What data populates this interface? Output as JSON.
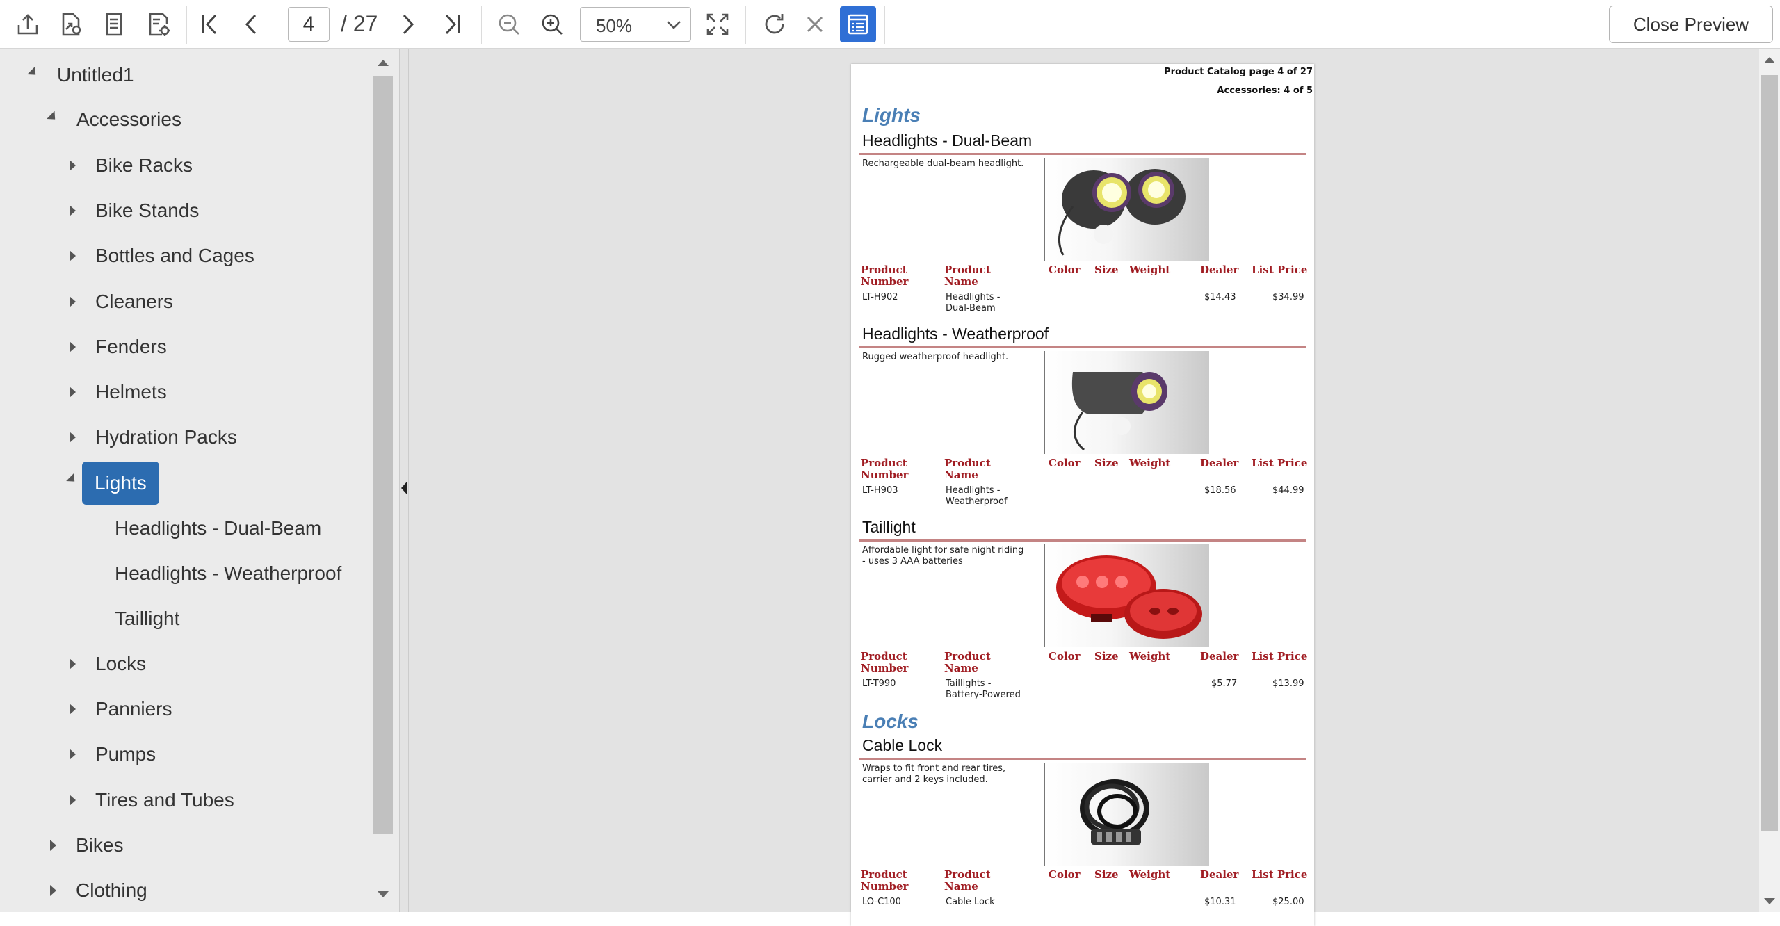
{
  "toolbar": {
    "current_page": "4",
    "total_pages": "/ 27",
    "zoom": "50%",
    "close_preview_label": "Close Preview"
  },
  "tree": {
    "root": "Untitled1",
    "accessories": "Accessories",
    "items": [
      "Bike Racks",
      "Bike Stands",
      "Bottles and Cages",
      "Cleaners",
      "Fenders",
      "Helmets",
      "Hydration Packs"
    ],
    "lights": "Lights",
    "lights_children": [
      "Headlights - Dual-Beam",
      "Headlights - Weatherproof",
      "Taillight"
    ],
    "items_after": [
      "Locks",
      "Panniers",
      "Pumps",
      "Tires and Tubes"
    ],
    "bikes": "Bikes",
    "clothing": "Clothing"
  },
  "report": {
    "header_line1": "Product Catalog page 4 of 27",
    "header_line2": "Accessories: 4 of 5",
    "columns": {
      "product_number": "Product Number",
      "product_name": "Product Name",
      "color": "Color",
      "size": "Size",
      "weight": "Weight",
      "dealer": "Dealer",
      "list_price": "List Price"
    },
    "categories": [
      {
        "title": "Lights",
        "products": [
          {
            "name": "Headlights - Dual-Beam",
            "description": "Rechargeable dual-beam headlight.",
            "number": "LT-H902",
            "prod_name": "Headlights - Dual-Beam",
            "dealer": "$14.43",
            "list_price": "$34.99"
          },
          {
            "name": "Headlights - Weatherproof",
            "description": "Rugged weatherproof headlight.",
            "number": "LT-H903",
            "prod_name": "Headlights - Weatherproof",
            "dealer": "$18.56",
            "list_price": "$44.99"
          },
          {
            "name": "Taillight",
            "description": "Affordable light for safe night riding - uses 3 AAA batteries",
            "number": "LT-T990",
            "prod_name": "Taillights - Battery-Powered",
            "dealer": "$5.77",
            "list_price": "$13.99"
          }
        ]
      },
      {
        "title": "Locks",
        "products": [
          {
            "name": "Cable Lock",
            "description": "Wraps to fit front and rear tires, carrier and 2 keys included.",
            "number": "LO-C100",
            "prod_name": "Cable Lock",
            "dealer": "$10.31",
            "list_price": "$25.00"
          }
        ]
      }
    ]
  }
}
